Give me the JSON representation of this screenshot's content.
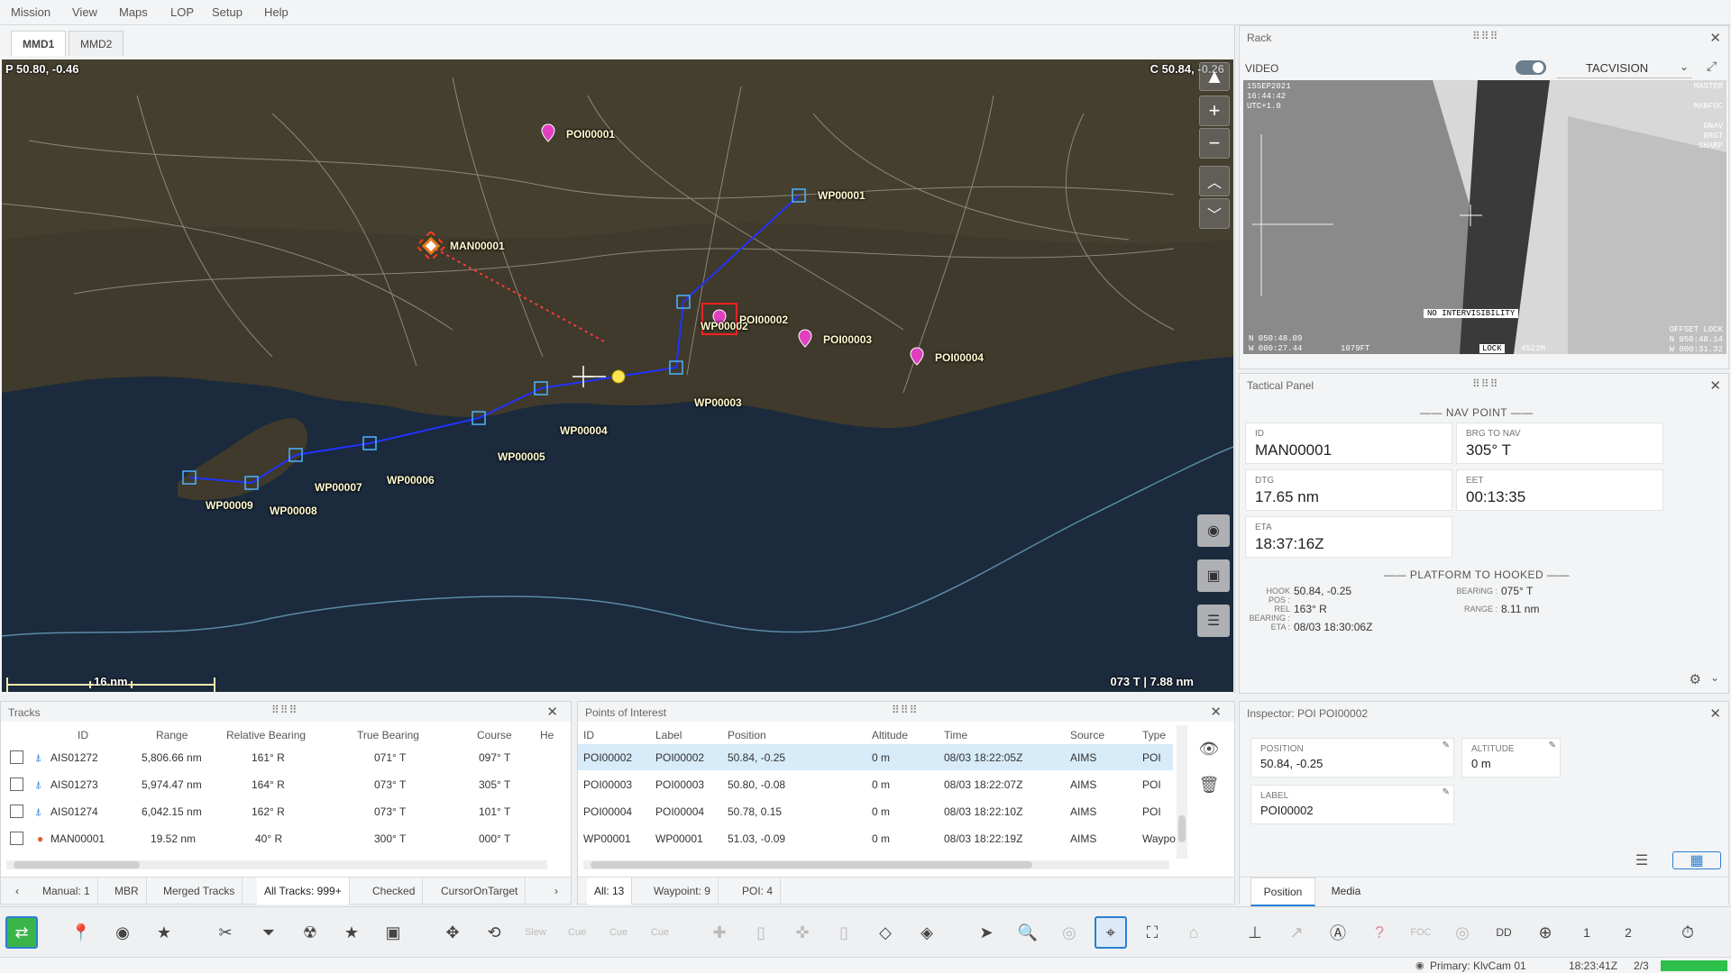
{
  "menu": [
    "Mission",
    "View",
    "Maps",
    "LOP",
    "Setup",
    "Help"
  ],
  "map_tabs": [
    "MMD1",
    "MMD2"
  ],
  "map": {
    "pointer_coord": "P 50.80, -0.46",
    "cursor_coord": "C 50.84, -0.26",
    "scale_label": "16 nm",
    "bearing_readout": "073   T | 7.88 nm",
    "waypoints": [
      "WP00001",
      "WP00002",
      "WP00003",
      "WP00004",
      "WP00005",
      "WP00006",
      "WP00007",
      "WP00008",
      "WP00009"
    ],
    "pois": [
      "POI00001",
      "POI00002",
      "POI00003",
      "POI00004"
    ],
    "man_label": "MAN00001"
  },
  "rack": {
    "title": "Rack",
    "video_label": "VIDEO",
    "source": "TACVISION",
    "overlay": {
      "date": "15SEP2021",
      "time": "16:44:42",
      "tz": "UTC+1.0",
      "master": "MASTER",
      "manfoc": "MANFOC",
      "gnav": "GNAV",
      "brgt": "BRGT",
      "sharp": "SHARP",
      "no_intervis": "NO INTERVISIBILITY",
      "bottom_left1": "N 050:48.09",
      "bottom_left2": "W 000:27.44",
      "ft": "1079FT",
      "lock": "LOCK",
      "range": "4522M",
      "bottom_right1": "N 050:48.14",
      "bottom_right2": "W 000:31.32",
      "offset_lock": "OFFSET LOCK"
    }
  },
  "tactical": {
    "title": "Tactical Panel",
    "nav_header": "NAV POINT",
    "fields": [
      {
        "label": "ID",
        "value": "MAN00001"
      },
      {
        "label": "BRG TO NAV",
        "value": "305° T"
      },
      {
        "label": "DTG",
        "value": "17.65 nm"
      },
      {
        "label": "EET",
        "value": "00:13:35"
      },
      {
        "label": "ETA",
        "value": "18:37:16Z"
      }
    ],
    "hook_header": "PLATFORM TO HOOKED",
    "hook": {
      "hook_pos_label": "HOOK POS :",
      "hook_pos": "50.84, -0.25",
      "bearing_label": "BEARING :",
      "bearing": "075° T",
      "rel_bearing_label": "REL BEARING :",
      "rel_bearing": "163° R",
      "range_label": "RANGE :",
      "range": "8.11 nm",
      "eta_label": "ETA :",
      "eta": "08/03 18:30:06Z"
    }
  },
  "inspector": {
    "title": "Inspector: POI POI00002",
    "position_label": "POSITION",
    "position": "50.84, -0.25",
    "altitude_label": "ALTITUDE",
    "altitude": "0 m",
    "label_label": "LABEL",
    "label": "POI00002",
    "tabs": [
      "Position",
      "Media"
    ]
  },
  "tracks": {
    "title": "Tracks",
    "columns": [
      "ID",
      "Range",
      "Relative Bearing",
      "True Bearing",
      "Course",
      "He"
    ],
    "rows": [
      {
        "id": "AIS01272",
        "range": "5,806.66 nm",
        "rel": "161° R",
        "true": "071° T",
        "course": "097° T"
      },
      {
        "id": "AIS01273",
        "range": "5,974.47 nm",
        "rel": "164° R",
        "true": "073° T",
        "course": "305° T"
      },
      {
        "id": "AIS01274",
        "range": "6,042.15 nm",
        "rel": "162° R",
        "true": "073° T",
        "course": "101° T"
      },
      {
        "id": "MAN00001",
        "range": "19.52 nm",
        "rel": "40° R",
        "true": "300° T",
        "course": "000° T"
      }
    ],
    "filters": [
      "Manual: 1",
      "MBR",
      "Merged Tracks",
      "All Tracks: 999+",
      "Checked",
      "CursorOnTarget"
    ]
  },
  "poi_table": {
    "title": "Points of Interest",
    "columns": [
      "ID",
      "Label",
      "Position",
      "Altitude",
      "Time",
      "Source",
      "Type"
    ],
    "rows": [
      {
        "id": "POI00002",
        "label": "POI00002",
        "pos": "50.84, -0.25",
        "alt": "0 m",
        "time": "08/03 18:22:05Z",
        "src": "AIMS",
        "type": "POI"
      },
      {
        "id": "POI00003",
        "label": "POI00003",
        "pos": "50.80, -0.08",
        "alt": "0 m",
        "time": "08/03 18:22:07Z",
        "src": "AIMS",
        "type": "POI"
      },
      {
        "id": "POI00004",
        "label": "POI00004",
        "pos": "50.78, 0.15",
        "alt": "0 m",
        "time": "08/03 18:22:10Z",
        "src": "AIMS",
        "type": "POI"
      },
      {
        "id": "WP00001",
        "label": "WP00001",
        "pos": "51.03, -0.09",
        "alt": "0 m",
        "time": "08/03 18:22:19Z",
        "src": "AIMS",
        "type": "Waypo"
      }
    ],
    "filters": [
      "All: 13",
      "Waypoint: 9",
      "POI: 4"
    ]
  },
  "toolbar_text": {
    "slew": "Slew",
    "cue": "Cue",
    "foc": "FOC",
    "dd": "DD",
    "num1": "1",
    "num2": "2"
  },
  "status": {
    "primary": "Primary: KlvCam 01",
    "time": "18:23:41Z",
    "page": "2/3"
  },
  "colors": {
    "route": "#2233ff",
    "poi": "#e040c0",
    "label": "#fffbd0",
    "accent": "#2a7fd4",
    "select_row": "#d7ebf8"
  }
}
